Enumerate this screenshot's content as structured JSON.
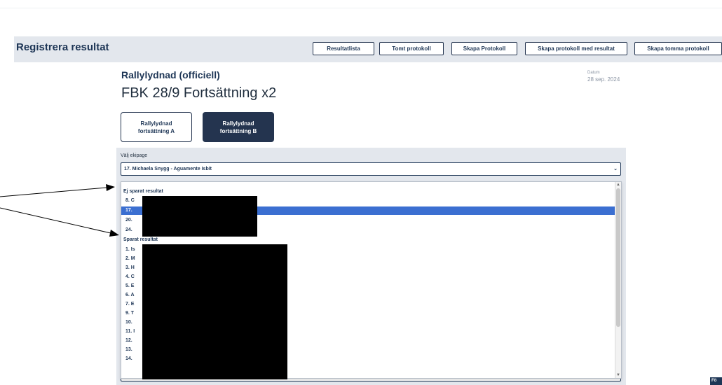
{
  "header": {
    "title": "Registrera resultat",
    "buttons": [
      "Resultatlista",
      "Tomt protokoll",
      "Skapa Protokoll",
      "Skapa protokoll med resultat",
      "Skapa tomma protokoll"
    ]
  },
  "event": {
    "organizer": "Rallylydnad (officiell)",
    "competition": "FBK 28/9 Fortsättning x2",
    "date_label": "Datum",
    "date_value": "28 sep. 2024"
  },
  "classes": [
    {
      "line1": "Rallylydnad",
      "line2": "fortsättning A"
    },
    {
      "line1": "Rallylydnad",
      "line2": "fortsättning B"
    }
  ],
  "select": {
    "label": "Välj ekipage",
    "value": "17. Michaela Snygg - Aguamente Isbit"
  },
  "dropdown": {
    "unsaved_group": "Ej sparat resultat",
    "unsaved_items": [
      "8. C",
      "17.",
      "20.",
      "24."
    ],
    "selected_index": 1,
    "saved_group": "Sparat resultat",
    "saved_items": [
      "1. Is",
      "2. M",
      "3. H",
      "4. C",
      "5. E",
      "6. A",
      "7. E",
      "9. T",
      "10.",
      "11. I",
      "12.",
      "13.",
      "14."
    ]
  },
  "corner_label": "Fö",
  "colors": {
    "brand": "#1e3656",
    "panel": "#e3e7ed",
    "highlight": "#3b6fd1"
  },
  "icons": {
    "select_chevron": "chevron-down-icon"
  }
}
